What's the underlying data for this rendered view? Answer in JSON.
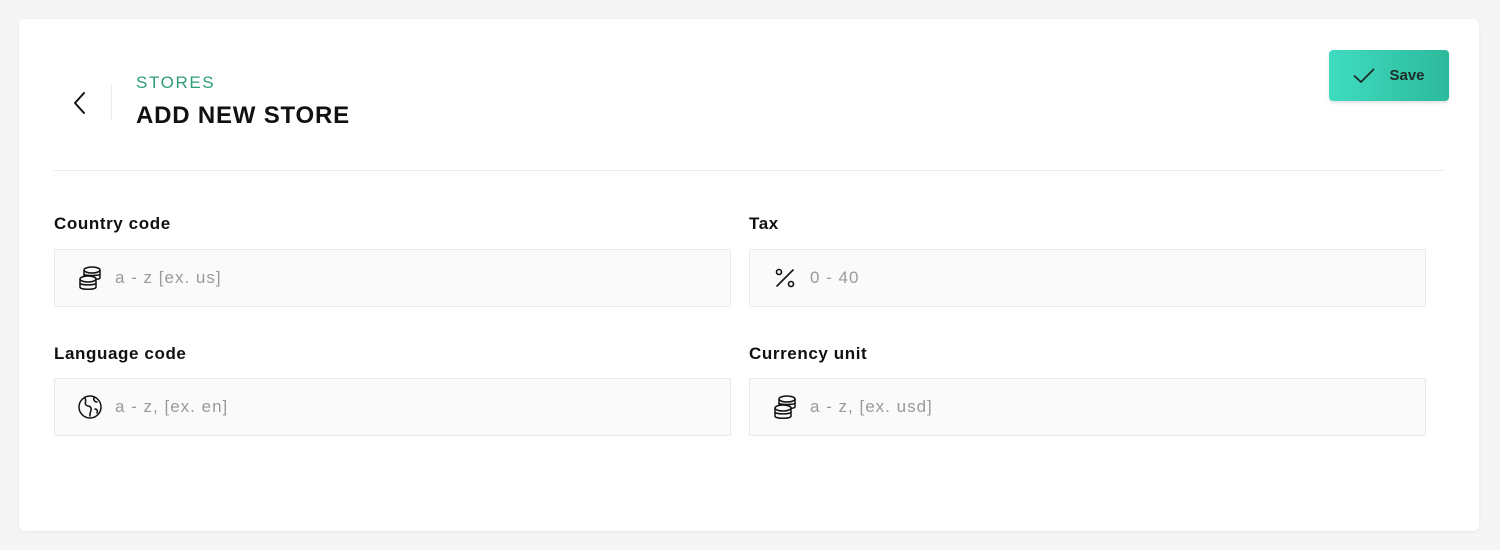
{
  "header": {
    "breadcrumb": "STORES",
    "title": "ADD NEW STORE",
    "back_icon": "chevron-left-icon",
    "save_label": "Save",
    "save_icon": "checkmark-icon",
    "accent_color": "#2e9c79",
    "save_gradient": [
      "#3fdcc0",
      "#2db99c"
    ]
  },
  "form": {
    "country_code": {
      "label": "Country code",
      "placeholder": "a - z [ex. us]",
      "value": "",
      "icon": "coins-stack-icon"
    },
    "tax": {
      "label": "Tax",
      "placeholder": "0 - 40",
      "value": "",
      "icon": "percent-icon"
    },
    "language_code": {
      "label": "Language code",
      "placeholder": "a - z, [ex. en]",
      "value": "",
      "icon": "globe-icon"
    },
    "currency_unit": {
      "label": "Currency unit",
      "placeholder": "a - z, [ex. usd]",
      "value": "",
      "icon": "coins-stack-icon"
    }
  }
}
